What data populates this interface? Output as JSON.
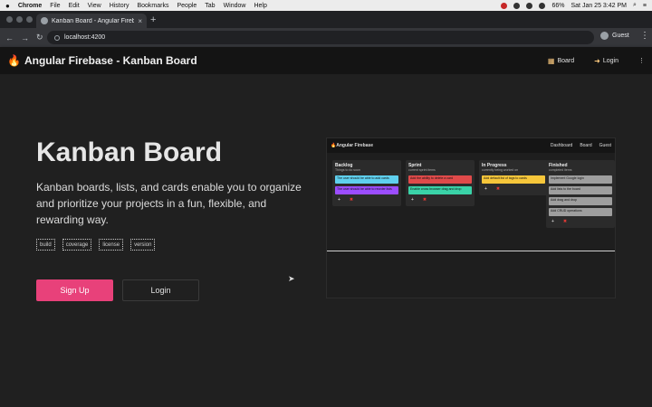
{
  "macos_menubar": {
    "app": "Chrome",
    "items": [
      "File",
      "Edit",
      "View",
      "History",
      "Bookmarks",
      "People",
      "Tab",
      "Window",
      "Help"
    ],
    "battery": "66%",
    "datetime": "Sat Jan 25  3:42 PM"
  },
  "browser": {
    "tab_title": "Kanban Board - Angular Firebase",
    "url": "localhost:4200",
    "profile": "Guest"
  },
  "app": {
    "brand": "Angular Firebase - Kanban Board",
    "board_label": "Board",
    "login_label": "Login"
  },
  "hero": {
    "title": "Kanban Board",
    "description": "Kanban boards, lists, and cards enable you to organize and prioritize your projects in a fun, flexible, and rewarding way.",
    "badges": [
      "build",
      "coverage",
      "license",
      "version"
    ],
    "signup_label": "Sign Up",
    "login_label": "Login"
  },
  "preview": {
    "brand": "Angular Firebase",
    "actions": [
      "Dashboard",
      "Board",
      "Guest"
    ],
    "lists": [
      {
        "title": "Backlog",
        "subtitle": "Things to do soon",
        "cards": [
          {
            "text": "The user should be able to add cards",
            "color": "#5fd0ee"
          },
          {
            "text": "The user should be able to reorder lists",
            "color": "#9c4dff"
          }
        ]
      },
      {
        "title": "Sprint",
        "subtitle": "current sprint items",
        "cards": [
          {
            "text": "Add the ability to delete a card",
            "color": "#e04a4a"
          },
          {
            "text": "Enable cross browser drag and drop",
            "color": "#3ad3a8"
          }
        ]
      },
      {
        "title": "In Progress",
        "subtitle": "currently being worked on",
        "cards": [
          {
            "text": "Add default list of tags to cards",
            "color": "#f6c63a"
          }
        ]
      },
      {
        "title": "Finished",
        "subtitle": "completed items",
        "cards": [
          {
            "text": "Implement Google login",
            "color": "#9e9e9e"
          },
          {
            "text": "Add lists to the board",
            "color": "#9e9e9e"
          },
          {
            "text": "Add drag and drop",
            "color": "#9e9e9e"
          },
          {
            "text": "Add CRUD operations",
            "color": "#9e9e9e"
          }
        ]
      }
    ]
  }
}
